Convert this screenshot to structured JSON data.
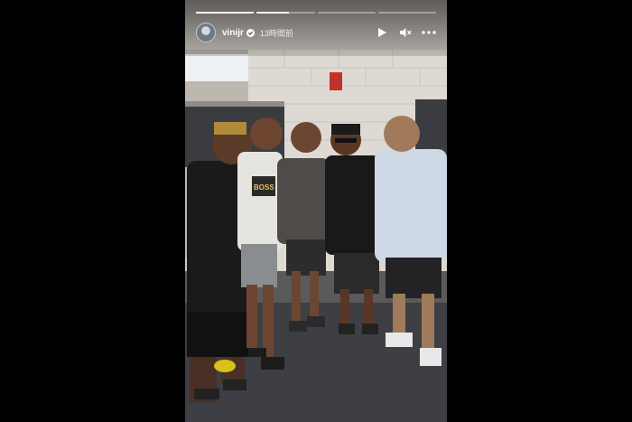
{
  "story": {
    "username": "vinijr",
    "time_ago": "13時間前",
    "progress": {
      "segments": 4,
      "active_index": 1,
      "active_fraction": 0.55
    },
    "icons": {
      "avatar": "profile-avatar",
      "verified": "verified-badge-icon",
      "play": "play-icon",
      "mute": "mute-icon",
      "more": "more-options-icon"
    },
    "photo": {
      "description_icon": "group-photo-image"
    }
  },
  "colors": {
    "page_background": "#000000",
    "text": "#ffffff"
  }
}
